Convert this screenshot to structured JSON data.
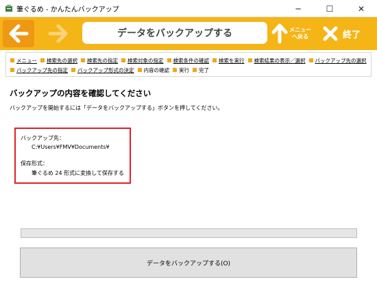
{
  "window": {
    "title": "筆ぐるめ - かんたんバックアップ",
    "icon": "app-icon",
    "minimize_glyph": "─",
    "maximize_glyph": "☐",
    "close_glyph": "✕"
  },
  "toolbar": {
    "title": "データをバックアップする",
    "menu_return_label_1": "メニュー",
    "menu_return_label_2": "へ戻る",
    "exit_label": "終了",
    "colors": {
      "bar": "#f5b517",
      "active_arrow_bg": "#ee9813",
      "disabled_arrow": "#f9d47a"
    }
  },
  "breadcrumb": {
    "line1": [
      "メニュー",
      "検索先の選択",
      "検索先の指定",
      "検索対象の指定",
      "検索条件の確認",
      "検索を実行",
      "検索結果の表示／選択",
      "バックアップ先の選択"
    ],
    "line2": [
      {
        "label": "バックアップ先の指定",
        "link": true
      },
      {
        "label": "バックアップ形式の決定",
        "link": true
      },
      {
        "label": "内容の確認",
        "link": false
      },
      {
        "label": "実行",
        "link": false
      },
      {
        "label": "完了",
        "link": false
      }
    ]
  },
  "main": {
    "heading": "バックアップの内容を確認してください",
    "instruction": "バックアップを開始するには「データをバックアップする」ボタンを押してください。"
  },
  "summary": {
    "destination_label": "バックアップ先：",
    "destination_value": "C:¥Users¥FMV¥Documents¥",
    "format_label": "保存形式：",
    "format_value": "筆ぐるめ 24 形式に変換して保存する",
    "highlight_color": "#e21d25"
  },
  "progress": {
    "value": 0
  },
  "action": {
    "backup_button_label": "データをバックアップする(O)"
  }
}
